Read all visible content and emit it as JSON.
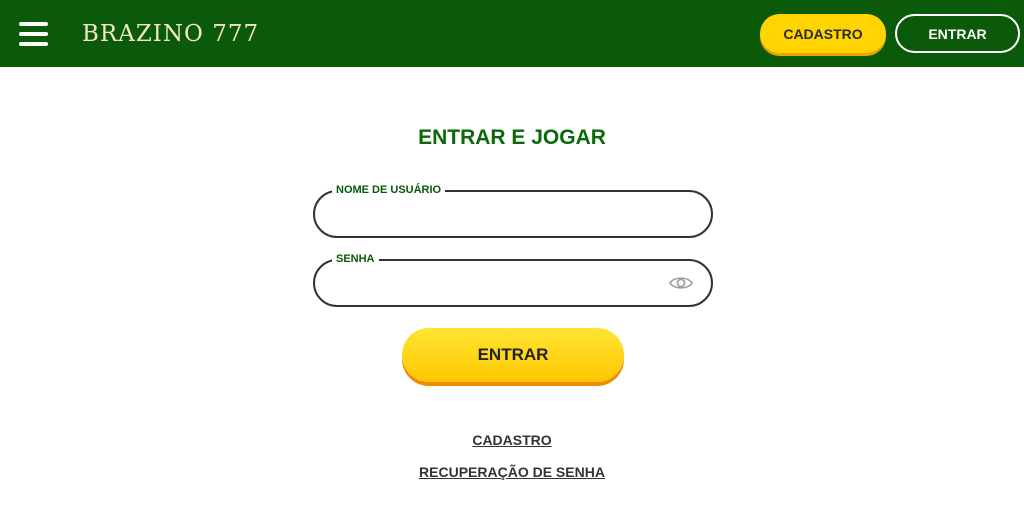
{
  "header": {
    "brand": "BRAZINO 777",
    "menu_icon": "hamburger-menu-icon",
    "register_label": "CADASTRO",
    "login_label": "ENTRAR",
    "background_color": "#0a5a0a",
    "accent_color": "#ffd400"
  },
  "login_form": {
    "title": "ENTRAR E JOGAR",
    "username": {
      "label": "NOME DE USUÁRIO",
      "value": ""
    },
    "password": {
      "label": "SENHA",
      "value": "",
      "toggle_icon": "eye-icon"
    },
    "submit_label": "ENTRAR"
  },
  "links": {
    "register": "CADASTRO",
    "recover_password": "RECUPERAÇÃO DE SENHA"
  }
}
